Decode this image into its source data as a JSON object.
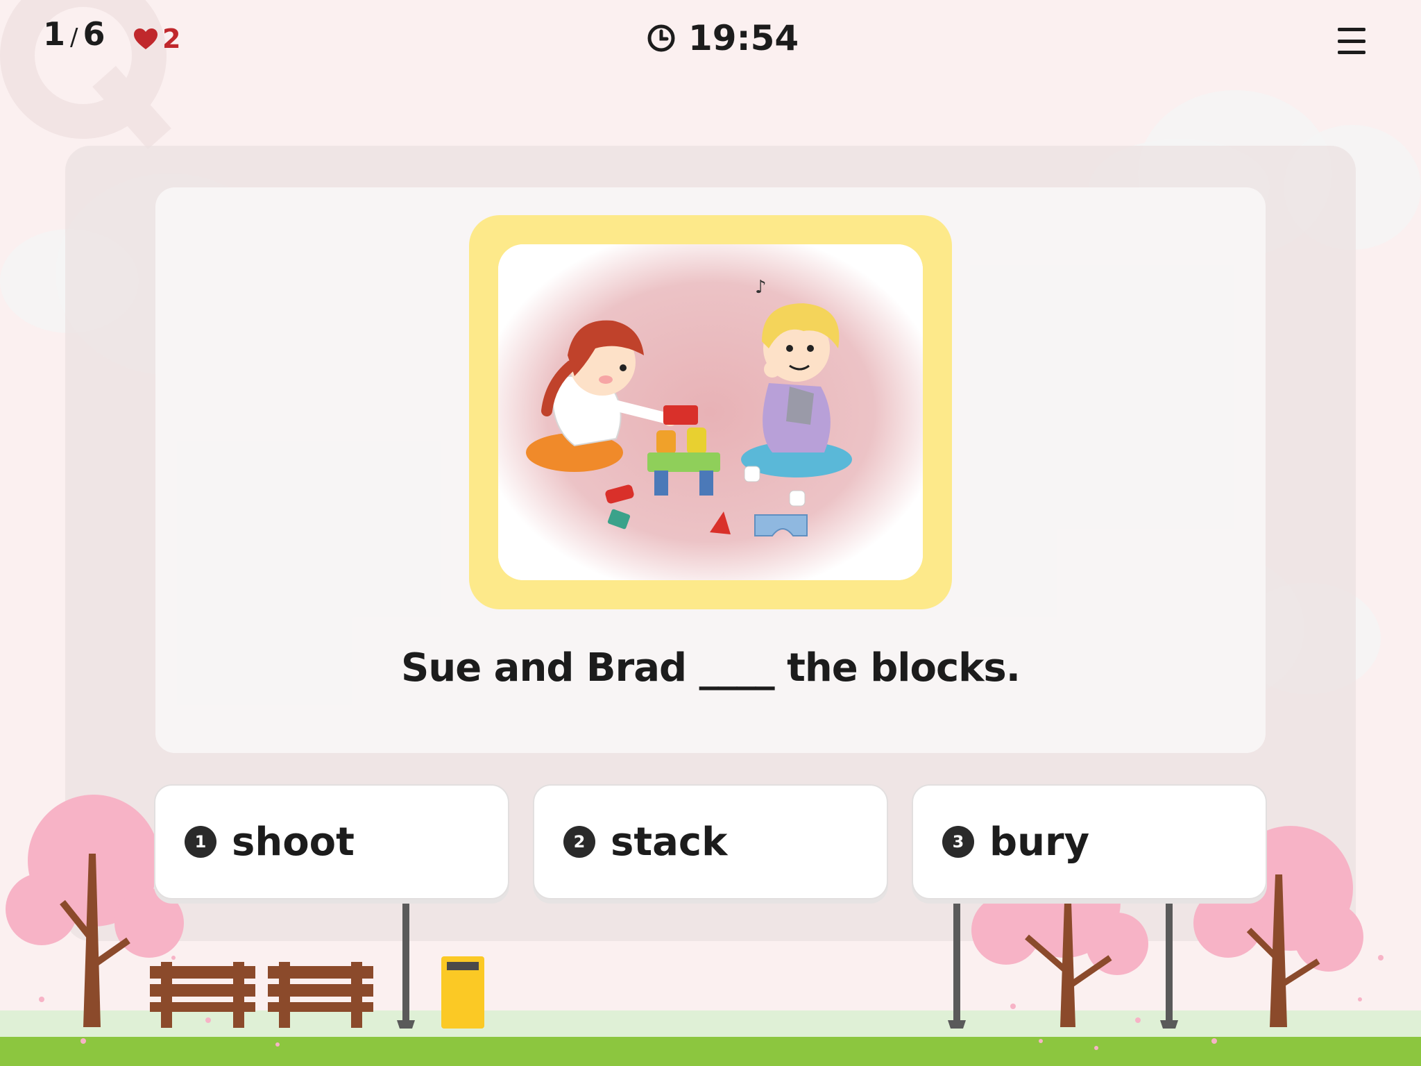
{
  "header": {
    "progress_current": "1",
    "progress_sep": "/",
    "progress_total": "6",
    "lives": "2",
    "timer": "19:54"
  },
  "icons": {
    "lives": "heart-icon",
    "timer": "clock-icon",
    "menu": "hamburger-menu-icon"
  },
  "question": {
    "text": "Sue and Brad ____ the blocks."
  },
  "options": [
    {
      "number": "1",
      "label": "shoot"
    },
    {
      "number": "2",
      "label": "stack"
    },
    {
      "number": "3",
      "label": "bury"
    }
  ],
  "colors": {
    "background": "#fbf0f0",
    "frame": "#fde98a",
    "heart": "#c0282c",
    "grass": "#8cc63f",
    "tree_pink": "#f7b3c6",
    "trunk": "#8b4a2b",
    "bench": "#8b4a2b",
    "trash_can": "#fbc925"
  }
}
